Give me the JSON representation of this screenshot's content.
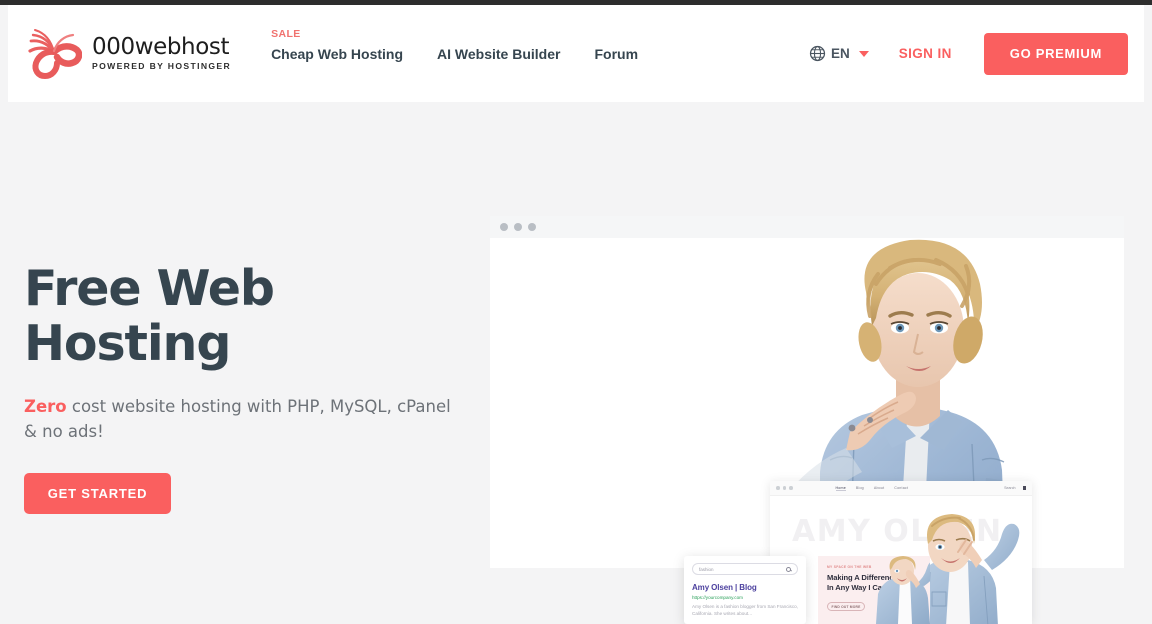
{
  "header": {
    "logo": {
      "icon": "pinwheel-swirl-logo",
      "title": "000webhost",
      "subtitle": "POWERED BY HOSTINGER"
    },
    "nav": [
      {
        "label": "Cheap Web Hosting",
        "badge": "SALE"
      },
      {
        "label": "AI Website Builder",
        "badge": ""
      },
      {
        "label": "Forum",
        "badge": ""
      }
    ],
    "language": {
      "icon": "globe-icon",
      "label": "EN",
      "chevron": "chevron-down-icon"
    },
    "sign_in_label": "SIGN IN",
    "premium_label": "GO PREMIUM"
  },
  "hero": {
    "title": "Free Web Hosting",
    "subtitle_highlight": "Zero",
    "subtitle_rest": " cost website hosting with PHP, MySQL, cPanel & no ads!",
    "cta_label": "GET STARTED"
  },
  "mockup": {
    "window_dots": 3,
    "inner_window": {
      "nav": [
        "Home",
        "Blog",
        "About",
        "Contact"
      ],
      "search_label": "Search",
      "cart_icon": "shopping-bag-icon",
      "watermark": "AMY OLSEN"
    },
    "search_card": {
      "query_placeholder": "fashion",
      "search_icon": "search-icon",
      "result_title": "Amy Olsen | Blog",
      "result_url": "https://yourcompany.com",
      "result_snippet": "Amy Olsen is a fashion blogger from San Francisco, California. She writes about..."
    },
    "promo_card": {
      "eyebrow": "MY SPACE ON THE WEB",
      "title_line1": "Making A Difference",
      "title_line2": "In Any Way I Can",
      "button_label": "FIND OUT MORE"
    }
  },
  "colors": {
    "accent": "#fa5f5f",
    "heading": "#36454f",
    "body_text": "#6d7278",
    "page_bg": "#f4f4f5",
    "result_title": "#4b3f9e",
    "result_url": "#2aa05a"
  }
}
